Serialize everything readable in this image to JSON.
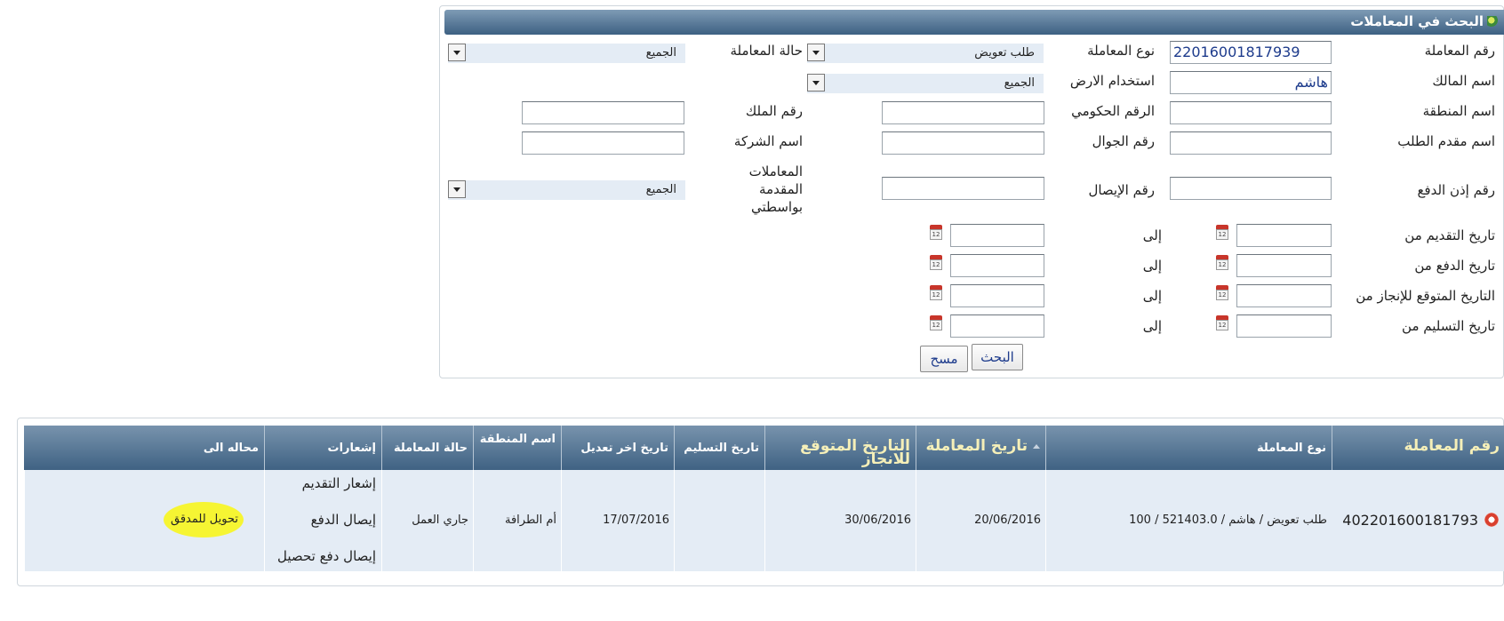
{
  "search": {
    "title": "البحث في المعاملات",
    "labels": {
      "transaction_number": "رقم المعاملة",
      "transaction_type": "نوع المعاملة",
      "transaction_status": "حالة المعاملة",
      "owner_name": "اسم المالك",
      "land_use": "استخدام الارض",
      "region_name": "اسم المنطقة",
      "gov_number": "الرقم الحكومي",
      "property_number": "رقم الملك",
      "applicant_name": "اسم مقدم الطلب",
      "mobile_number": "رقم الجوال",
      "company_name": "اسم الشركة",
      "payment_order_number": "رقم إذن الدفع",
      "receipt_number": "رقم الإيصال",
      "submitted_by_me": "المعاملات المقدمة بواسطتي",
      "submit_date_from": "تاريخ التقديم من",
      "payment_date_from": "تاريخ الدفع من",
      "expected_date_from": "التاريخ المتوقع للإنجاز من",
      "delivery_date_from": "تاريخ التسليم من",
      "to": "إلى"
    },
    "values": {
      "transaction_number": "22016001817939",
      "owner_name": "هاشم",
      "transaction_type": "طلب تعويض",
      "transaction_status": "الجميع",
      "land_use": "الجميع",
      "submitted_by_me": "الجميع"
    },
    "calendar_glyph": "12",
    "buttons": {
      "search": "البحث",
      "clear": "مسح"
    }
  },
  "grid": {
    "headers": {
      "transaction_number": "رقم المعاملة",
      "transaction_type": "نوع المعاملة",
      "transaction_date": "تاريخ المعاملة",
      "expected_date": "التاريخ المتوقع للانجاز",
      "delivery_date": "تاريخ التسليم",
      "last_modified": "تاريخ اخر تعديل",
      "region_name": "اسم المنطقة",
      "status": "حالة المعاملة",
      "notifications": "إشعارات",
      "referred_to": "محاله الى"
    },
    "rows": [
      {
        "transaction_number": "402201600181793",
        "transaction_type": "طلب تعويض / هاشم / 521403.0 / 100",
        "transaction_date": "20/06/2016",
        "expected_date": "30/06/2016",
        "delivery_date": "",
        "last_modified": "17/07/2016",
        "region_name": "أم الطرافة",
        "status": "جاري العمل",
        "notifications": [
          "إشعار التقديم",
          "إيصال الدفع",
          "إيصال دفع تحصيل"
        ],
        "referred_to": "تحويل للمدقق"
      }
    ]
  },
  "colors": {
    "header_top": "#7893ad",
    "header_bottom": "#3f6283",
    "row_bg": "#e4ecf5",
    "highlight": "#f6f533"
  }
}
